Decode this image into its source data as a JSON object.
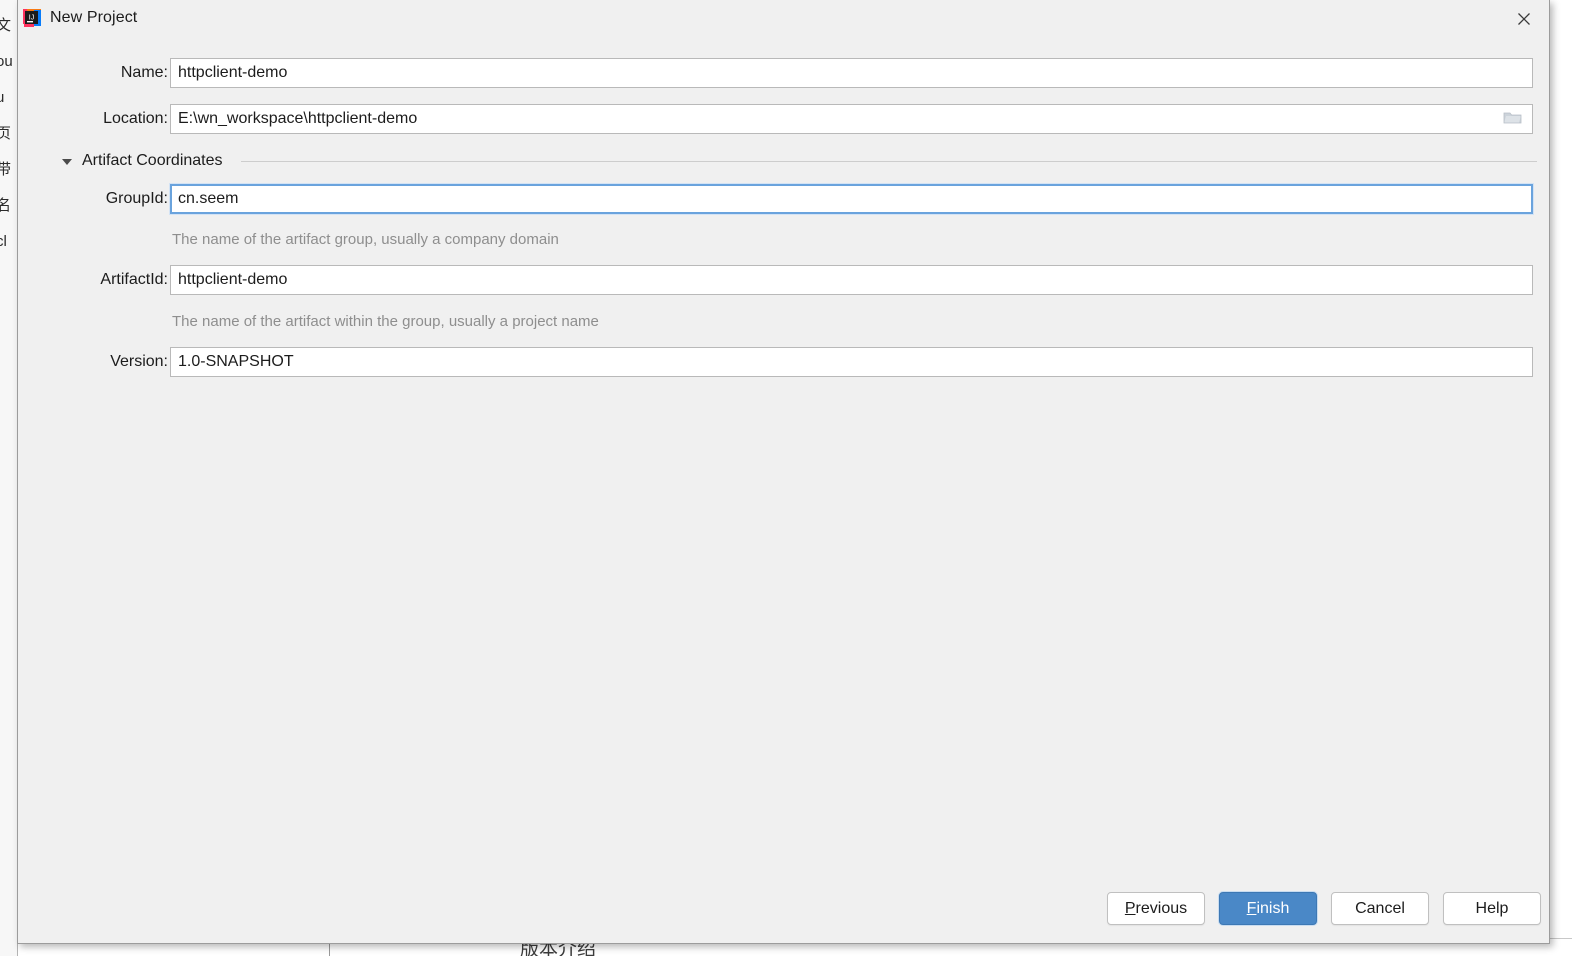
{
  "background": {
    "left_strip_glyphs": "文\nou\nu\n页\n带\n名\ncl",
    "bottom_text": "版本介绍"
  },
  "dialog": {
    "title": "New Project",
    "icon": "intellij-idea-logo",
    "close_icon": "close-icon"
  },
  "form": {
    "name": {
      "label": "Name:",
      "value": "httpclient-demo"
    },
    "location": {
      "label": "Location:",
      "value": "E:\\wn_workspace\\httpclient-demo",
      "browse_icon": "folder-icon"
    },
    "section": {
      "title": "Artifact Coordinates",
      "expanded": true,
      "toggle_icon": "chevron-down-icon"
    },
    "group_id": {
      "label": "GroupId:",
      "value": "cn.seem",
      "hint": "The name of the artifact group, usually a company domain",
      "focused": true
    },
    "artifact_id": {
      "label": "ArtifactId:",
      "value": "httpclient-demo",
      "hint": "The name of the artifact within the group, usually a project name"
    },
    "version": {
      "label": "Version:",
      "value": "1.0-SNAPSHOT"
    }
  },
  "buttons": {
    "previous": {
      "label": "Previous",
      "mnemonic": "P",
      "rest": "revious"
    },
    "finish": {
      "label": "Finish",
      "mnemonic": "F",
      "rest": "inish",
      "primary": true,
      "color": "#4a88c7"
    },
    "cancel": {
      "label": "Cancel"
    },
    "help": {
      "label": "Help"
    }
  }
}
